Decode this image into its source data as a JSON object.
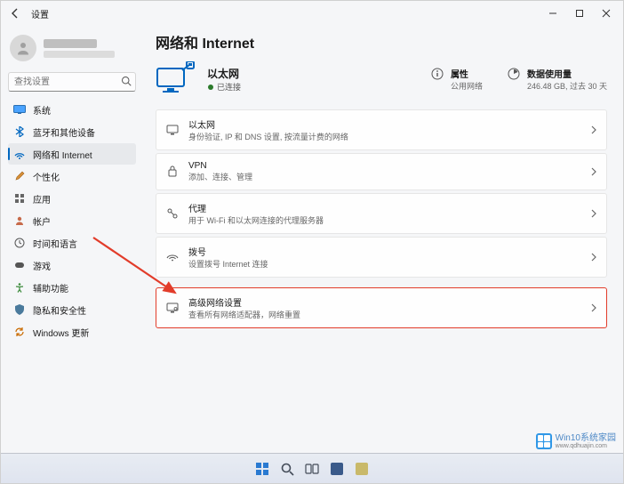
{
  "window": {
    "title": "设置"
  },
  "search": {
    "placeholder": "查找设置"
  },
  "sidebar": {
    "items": [
      {
        "label": "系统",
        "icon": "system"
      },
      {
        "label": "蓝牙和其他设备",
        "icon": "bluetooth"
      },
      {
        "label": "网络和 Internet",
        "icon": "network"
      },
      {
        "label": "个性化",
        "icon": "personalize"
      },
      {
        "label": "应用",
        "icon": "apps"
      },
      {
        "label": "帐户",
        "icon": "accounts"
      },
      {
        "label": "时间和语言",
        "icon": "time"
      },
      {
        "label": "游戏",
        "icon": "gaming"
      },
      {
        "label": "辅助功能",
        "icon": "accessibility"
      },
      {
        "label": "隐私和安全性",
        "icon": "privacy"
      },
      {
        "label": "Windows 更新",
        "icon": "update"
      }
    ]
  },
  "page": {
    "title": "网络和 Internet",
    "hero": {
      "name": "以太网",
      "status": "已连接"
    },
    "stats": {
      "props": {
        "title": "属性",
        "sub": "公用网络"
      },
      "data": {
        "title": "数据使用量",
        "sub": "246.48 GB, 过去 30 天"
      }
    },
    "cards": [
      {
        "key": "ethernet",
        "title": "以太网",
        "sub": "身份验证, IP 和 DNS 设置, 按流量计费的网络"
      },
      {
        "key": "vpn",
        "title": "VPN",
        "sub": "添加、连接、管理"
      },
      {
        "key": "proxy",
        "title": "代理",
        "sub": "用于 Wi-Fi 和以太网连接的代理服务器"
      },
      {
        "key": "dialup",
        "title": "拨号",
        "sub": "设置拨号 Internet 连接"
      },
      {
        "key": "advanced",
        "title": "高级网络设置",
        "sub": "查看所有网络适配器，网络重置"
      }
    ]
  },
  "watermark": {
    "title": "Win10系统家园",
    "url": "www.qdhuajin.com"
  },
  "colors": {
    "accent": "#0067c0",
    "highlight_border": "#e23c2a"
  }
}
